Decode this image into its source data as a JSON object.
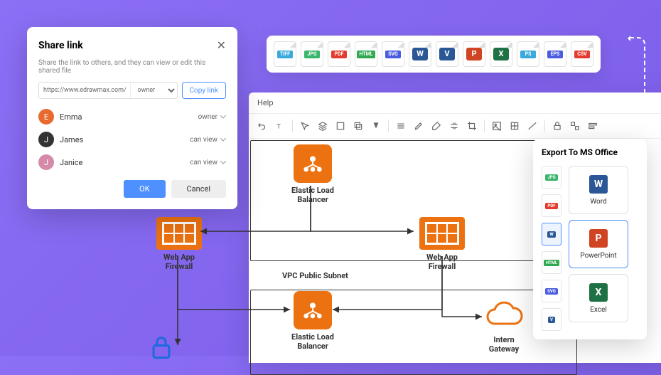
{
  "share": {
    "title": "Share link",
    "subtitle": "Share the link to others, and they can view or edit this shared file",
    "url": "https://www.edrawmax.com/online/fil",
    "role_default": "owner",
    "copy_label": "Copy link",
    "ok_label": "OK",
    "cancel_label": "Cancel",
    "users": [
      {
        "name": "Emma",
        "perm": "owner",
        "color": "#e86a2f"
      },
      {
        "name": "James",
        "perm": "can view",
        "color": "#333"
      },
      {
        "name": "Janice",
        "perm": "can view",
        "color": "#d48aa8"
      }
    ]
  },
  "canvas": {
    "menu_help": "Help",
    "nodes": {
      "elb1": "Elastic Load\nBalancer",
      "elb2": "Elastic Load\nBalancer",
      "waf1": "Web App\nFirewall",
      "waf2": "Web App\nFirewall",
      "subnet": "VPC Public Subnet",
      "igw": "Intern\nGateway"
    }
  },
  "export_bar": [
    {
      "name": "tiff",
      "label": "TIFF",
      "color": "#3aa9db"
    },
    {
      "name": "jpg",
      "label": "JPG",
      "color": "#3bb56a"
    },
    {
      "name": "pdf",
      "label": "PDF",
      "color": "#e33b2e"
    },
    {
      "name": "html",
      "label": "HTML",
      "color": "#2fa84f"
    },
    {
      "name": "svg",
      "label": "SVG",
      "color": "#4a5de0"
    },
    {
      "name": "word",
      "label": "W",
      "color": "#2b5797",
      "icon": true
    },
    {
      "name": "visio",
      "label": "V",
      "color": "#2b5797",
      "icon": true
    },
    {
      "name": "ppt",
      "label": "P",
      "color": "#d04423",
      "icon": true
    },
    {
      "name": "excel",
      "label": "X",
      "color": "#1e7145",
      "icon": true
    },
    {
      "name": "ps",
      "label": "PS",
      "color": "#3aa9db"
    },
    {
      "name": "eps",
      "label": "EPS",
      "color": "#4a5de0"
    },
    {
      "name": "csv",
      "label": "CSV",
      "color": "#e33b2e"
    }
  ],
  "export_panel": {
    "title": "Export To MS Office",
    "left": [
      {
        "name": "jpg",
        "label": "JPG",
        "color": "#3bb56a"
      },
      {
        "name": "pdf",
        "label": "PDF",
        "color": "#e33b2e"
      },
      {
        "name": "word",
        "label": "W",
        "color": "#2b5797",
        "selected": true
      },
      {
        "name": "html",
        "label": "HTML",
        "color": "#2fa84f"
      },
      {
        "name": "svg",
        "label": "SVG",
        "color": "#4a5de0"
      },
      {
        "name": "visio",
        "label": "V",
        "color": "#2b5797"
      }
    ],
    "cards": [
      {
        "name": "word",
        "label": "Word",
        "color": "#2b5797",
        "letter": "W"
      },
      {
        "name": "ppt",
        "label": "PowerPoint",
        "color": "#d04423",
        "letter": "P",
        "selected": true
      },
      {
        "name": "excel",
        "label": "Excel",
        "color": "#1e7145",
        "letter": "X"
      }
    ]
  }
}
